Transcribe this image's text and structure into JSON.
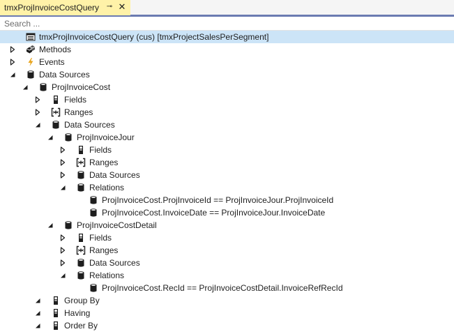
{
  "tab": {
    "title": "tmxProjInvoiceCostQuery",
    "pin_glyph": "⊸",
    "close_glyph": "✕"
  },
  "search": {
    "placeholder": "Search ..."
  },
  "tree": [
    {
      "label": "tmxProjInvoiceCostQuery (cus) [tmxProjectSalesPerSegment]",
      "level": 0,
      "expander": "none",
      "icon": "query-icon",
      "selected": true
    },
    {
      "label": "Methods",
      "level": 0,
      "expander": "collapsed",
      "icon": "methods-icon"
    },
    {
      "label": "Events",
      "level": 0,
      "expander": "collapsed",
      "icon": "event-icon"
    },
    {
      "label": "Data Sources",
      "level": 0,
      "expander": "expanded",
      "icon": "database-icon"
    },
    {
      "label": "ProjInvoiceCost",
      "level": 1,
      "expander": "expanded",
      "icon": "database-icon"
    },
    {
      "label": "Fields",
      "level": 2,
      "expander": "collapsed",
      "icon": "field-icon"
    },
    {
      "label": "Ranges",
      "level": 2,
      "expander": "collapsed",
      "icon": "range-icon"
    },
    {
      "label": "Data Sources",
      "level": 2,
      "expander": "expanded",
      "icon": "database-icon"
    },
    {
      "label": "ProjInvoiceJour",
      "level": 3,
      "expander": "expanded",
      "icon": "database-icon"
    },
    {
      "label": "Fields",
      "level": 4,
      "expander": "collapsed",
      "icon": "field-icon"
    },
    {
      "label": "Ranges",
      "level": 4,
      "expander": "collapsed",
      "icon": "range-icon"
    },
    {
      "label": "Data Sources",
      "level": 4,
      "expander": "collapsed",
      "icon": "database-icon"
    },
    {
      "label": "Relations",
      "level": 4,
      "expander": "expanded",
      "icon": "database-icon"
    },
    {
      "label": "ProjInvoiceCost.ProjInvoiceId == ProjInvoiceJour.ProjInvoiceId",
      "level": 5,
      "expander": "none",
      "icon": "database-icon"
    },
    {
      "label": "ProjInvoiceCost.InvoiceDate == ProjInvoiceJour.InvoiceDate",
      "level": 5,
      "expander": "none",
      "icon": "database-icon"
    },
    {
      "label": "ProjInvoiceCostDetail",
      "level": 3,
      "expander": "expanded",
      "icon": "database-icon"
    },
    {
      "label": "Fields",
      "level": 4,
      "expander": "collapsed",
      "icon": "field-icon"
    },
    {
      "label": "Ranges",
      "level": 4,
      "expander": "collapsed",
      "icon": "range-icon"
    },
    {
      "label": "Data Sources",
      "level": 4,
      "expander": "collapsed",
      "icon": "database-icon"
    },
    {
      "label": "Relations",
      "level": 4,
      "expander": "expanded",
      "icon": "database-icon"
    },
    {
      "label": "ProjInvoiceCost.RecId == ProjInvoiceCostDetail.InvoiceRefRecId",
      "level": 5,
      "expander": "none",
      "icon": "database-icon"
    },
    {
      "label": "Group By",
      "level": 2,
      "expander": "expanded",
      "icon": "field-icon"
    },
    {
      "label": "Having",
      "level": 2,
      "expander": "expanded",
      "icon": "field-icon"
    },
    {
      "label": "Order By",
      "level": 2,
      "expander": "expanded",
      "icon": "field-icon"
    }
  ],
  "colors": {
    "tab_active_bg": "#fff2a8",
    "tab_strip_border": "#6b7bb1",
    "selection": "#cce4f7",
    "event_icon": "#e8a31a",
    "text": "#1e1e1e"
  }
}
